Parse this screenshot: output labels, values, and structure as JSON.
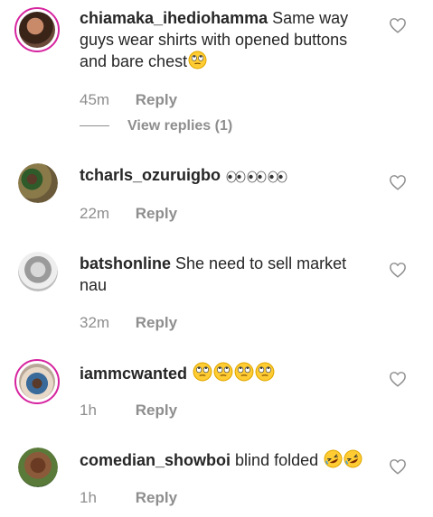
{
  "comments": [
    {
      "username": "chiamaka_ihediohamma",
      "text": "Same way guys wear shirts with opened buttons and bare chest",
      "emojis": [
        "rolling-eyes"
      ],
      "time": "45m",
      "reply_label": "Reply",
      "view_replies": "View replies (1)",
      "avatar_ring": true
    },
    {
      "username": "tcharls_ozuruigbo",
      "text": "",
      "emojis": [
        "eyes",
        "eyes",
        "eyes"
      ],
      "time": "22m",
      "reply_label": "Reply",
      "avatar_ring": false
    },
    {
      "username": "batshonline",
      "text": "She need to sell market nau",
      "emojis": [],
      "time": "32m",
      "reply_label": "Reply",
      "avatar_ring": false
    },
    {
      "username": "iammcwanted",
      "text": "",
      "emojis": [
        "rolling-eyes",
        "rolling-eyes",
        "rolling-eyes",
        "rolling-eyes"
      ],
      "time": "1h",
      "reply_label": "Reply",
      "avatar_ring": true
    },
    {
      "username": "comedian_showboi",
      "text": "blind folded",
      "emojis": [
        "rolling-laughing",
        "rolling-laughing"
      ],
      "time": "1h",
      "reply_label": "Reply",
      "avatar_ring": false
    }
  ],
  "colors": {
    "text": "#262626",
    "secondary": "#8e8e8e",
    "story_ring": "#d6249f",
    "emoji_yellow": "#ffcc33"
  },
  "icons": {
    "like": "heart-outline-icon"
  }
}
